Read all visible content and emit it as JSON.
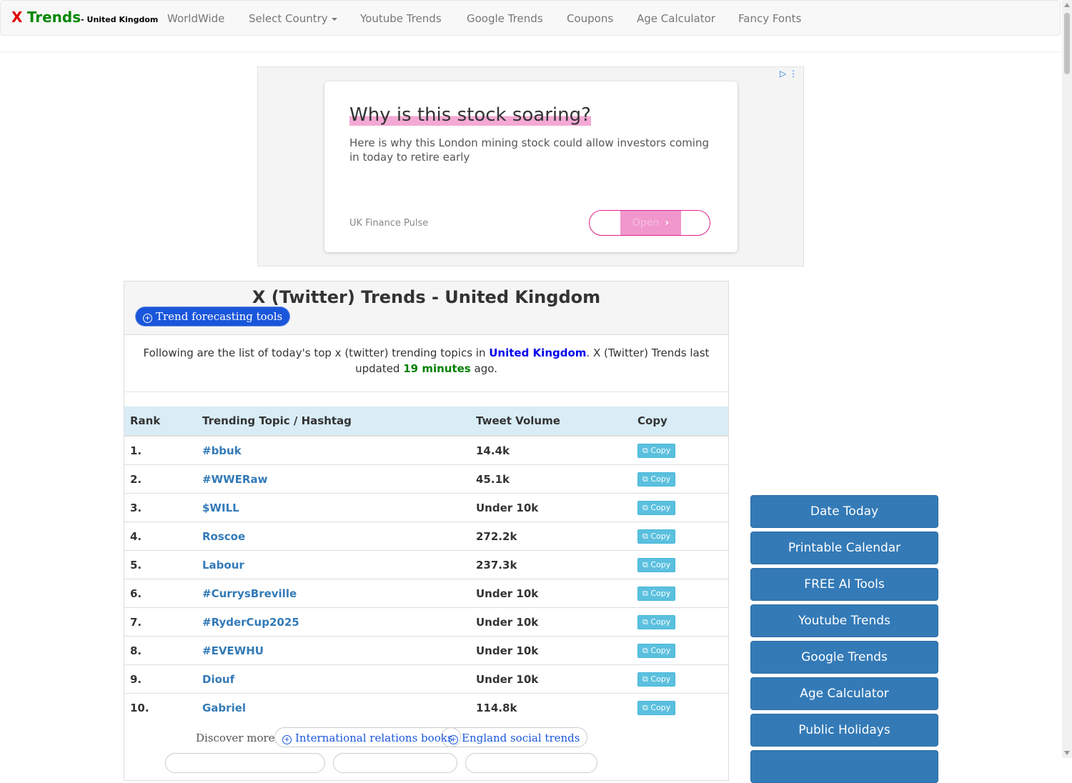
{
  "nav": {
    "brand_x": "X",
    "brand_trends": "Trends",
    "brand_country": "- United Kingdom",
    "items": [
      "WorldWide",
      "Select Country",
      "Youtube Trends",
      "Google Trends",
      "Coupons",
      "Age Calculator",
      "Fancy Fonts"
    ]
  },
  "ad": {
    "headline": "Why is this stock soaring?",
    "body": "Here is why this London mining stock could allow investors coming in today to retire early",
    "source": "UK Finance Pulse",
    "button": "Open",
    "choices_icon": "adchoices-icon"
  },
  "panel": {
    "title": "X (Twitter) Trends - United Kingdom",
    "forecast_button": "Trend forecasting tools",
    "intro_before": "Following are the list of today's top x (twitter) trending topics in ",
    "intro_country": "United Kingdom",
    "intro_middle": ". X (Twitter) Trends last updated ",
    "intro_minutes": "19 minutes",
    "intro_after": " ago."
  },
  "table": {
    "headers": [
      "Rank",
      "Trending Topic / Hashtag",
      "Tweet Volume",
      "Copy"
    ],
    "rows": [
      {
        "rank": "1.",
        "topic": "#bbuk",
        "volume": "14.4k",
        "copy": "Copy"
      },
      {
        "rank": "2.",
        "topic": "#WWERaw",
        "volume": "45.1k",
        "copy": "Copy"
      },
      {
        "rank": "3.",
        "topic": "$WILL",
        "volume": "Under 10k",
        "copy": "Copy"
      },
      {
        "rank": "4.",
        "topic": "Roscoe",
        "volume": "272.2k",
        "copy": "Copy"
      },
      {
        "rank": "5.",
        "topic": "Labour",
        "volume": "237.3k",
        "copy": "Copy"
      },
      {
        "rank": "6.",
        "topic": "#CurrysBreville",
        "volume": "Under 10k",
        "copy": "Copy"
      },
      {
        "rank": "7.",
        "topic": "#RyderCup2025",
        "volume": "Under 10k",
        "copy": "Copy"
      },
      {
        "rank": "8.",
        "topic": "#EVEWHU",
        "volume": "Under 10k",
        "copy": "Copy"
      },
      {
        "rank": "9.",
        "topic": "Diouf",
        "volume": "Under 10k",
        "copy": "Copy"
      },
      {
        "rank": "10.",
        "topic": "Gabriel",
        "volume": "114.8k",
        "copy": "Copy"
      }
    ]
  },
  "discover": {
    "label": "Discover more",
    "pills": [
      "International relations books",
      "England social trends"
    ]
  },
  "sidebar": {
    "buttons": [
      "Date Today",
      "Printable Calendar",
      "FREE AI Tools",
      "Youtube Trends",
      "Google Trends",
      "Age Calculator",
      "Public Holidays"
    ]
  }
}
